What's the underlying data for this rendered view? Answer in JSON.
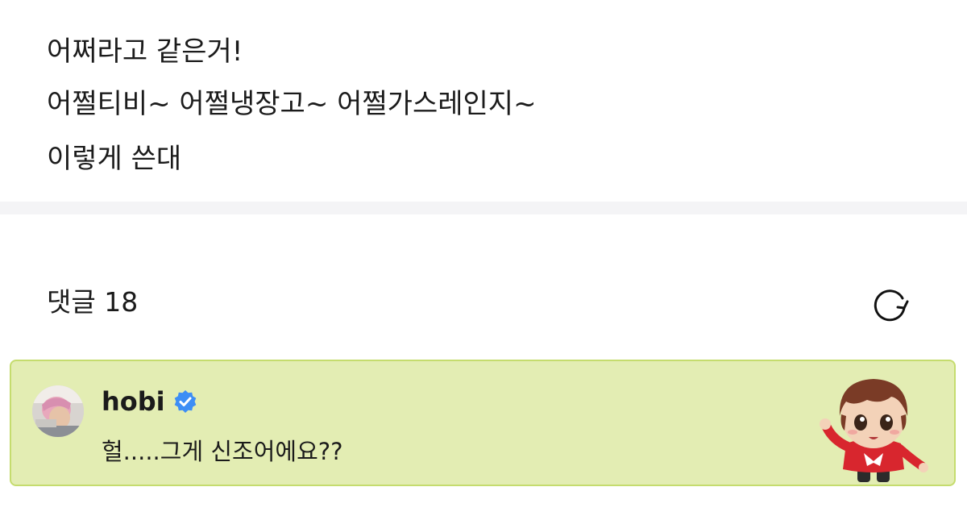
{
  "post": {
    "lines": [
      "어쩌라고 같은거!",
      "어쩔티비~ 어쩔냉장고~ 어쩔가스레인지~",
      "이렇게 쓴대"
    ]
  },
  "comments": {
    "label": "댓글 18",
    "refresh_icon": "refresh-icon"
  },
  "comment": {
    "author": "hobi",
    "verified_icon": "verified-badge-icon",
    "text": "헐.....그게 신조어에요??",
    "sticker": "character-sticker",
    "colors": {
      "card_background": "#e3edb3",
      "card_border": "#c5dc6e",
      "verified": "#3d8ef5"
    }
  }
}
